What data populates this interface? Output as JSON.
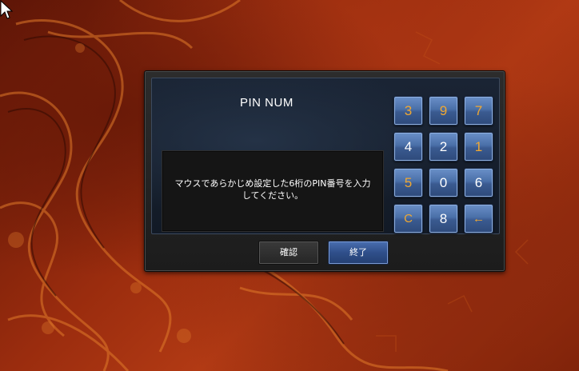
{
  "dialog": {
    "title": "PIN NUM",
    "message_line1": "マウスであらかじめ設定した6桁のPIN番号を入力",
    "message_line2": "してください。",
    "confirm_label": "確認",
    "exit_label": "終了"
  },
  "keypad": {
    "keys": [
      {
        "label": "3",
        "color": "gold"
      },
      {
        "label": "9",
        "color": "gold"
      },
      {
        "label": "7",
        "color": "gold"
      },
      {
        "label": "4",
        "color": "white"
      },
      {
        "label": "2",
        "color": "white"
      },
      {
        "label": "1",
        "color": "gold"
      },
      {
        "label": "5",
        "color": "gold"
      },
      {
        "label": "0",
        "color": "white"
      },
      {
        "label": "6",
        "color": "white"
      },
      {
        "label": "C",
        "color": "gold",
        "meaning": "clear"
      },
      {
        "label": "8",
        "color": "white"
      },
      {
        "label": "←",
        "color": "gold",
        "meaning": "backspace"
      }
    ]
  },
  "colors": {
    "key_gold": "#f0a832",
    "key_blue": "#4a6fa8",
    "background_red": "#9a2c0e"
  }
}
